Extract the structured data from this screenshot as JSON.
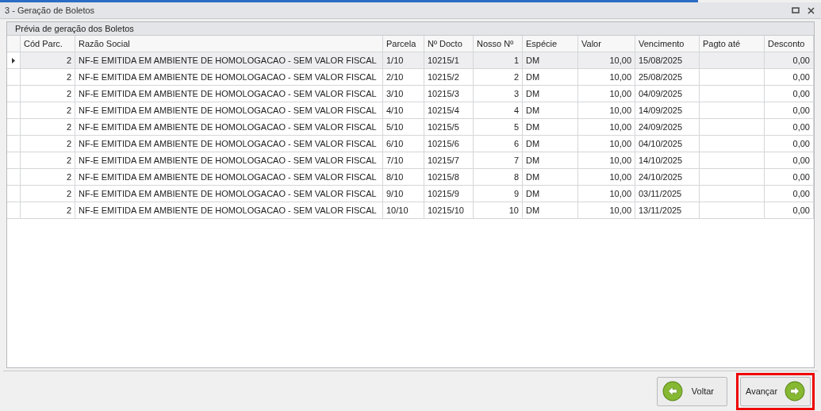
{
  "window": {
    "title": "3 - Geração de Boletos"
  },
  "panel": {
    "title": "Prévia de geração dos Boletos"
  },
  "table": {
    "columns": [
      "Cód Parc.",
      "Razão Social",
      "Parcela",
      "Nº Docto",
      "Nosso Nº",
      "Espécie",
      "Valor",
      "Vencimento",
      "Pagto até",
      "Desconto"
    ],
    "rows": [
      {
        "selected": true,
        "cells": [
          "2",
          "NF-E EMITIDA EM AMBIENTE DE HOMOLOGACAO - SEM VALOR FISCAL",
          "1/10",
          "10215/1",
          "1",
          "DM",
          "10,00",
          "15/08/2025",
          "",
          "0,00"
        ]
      },
      {
        "selected": false,
        "cells": [
          "2",
          "NF-E EMITIDA EM AMBIENTE DE HOMOLOGACAO - SEM VALOR FISCAL",
          "2/10",
          "10215/2",
          "2",
          "DM",
          "10,00",
          "25/08/2025",
          "",
          "0,00"
        ]
      },
      {
        "selected": false,
        "cells": [
          "2",
          "NF-E EMITIDA EM AMBIENTE DE HOMOLOGACAO - SEM VALOR FISCAL",
          "3/10",
          "10215/3",
          "3",
          "DM",
          "10,00",
          "04/09/2025",
          "",
          "0,00"
        ]
      },
      {
        "selected": false,
        "cells": [
          "2",
          "NF-E EMITIDA EM AMBIENTE DE HOMOLOGACAO - SEM VALOR FISCAL",
          "4/10",
          "10215/4",
          "4",
          "DM",
          "10,00",
          "14/09/2025",
          "",
          "0,00"
        ]
      },
      {
        "selected": false,
        "cells": [
          "2",
          "NF-E EMITIDA EM AMBIENTE DE HOMOLOGACAO - SEM VALOR FISCAL",
          "5/10",
          "10215/5",
          "5",
          "DM",
          "10,00",
          "24/09/2025",
          "",
          "0,00"
        ]
      },
      {
        "selected": false,
        "cells": [
          "2",
          "NF-E EMITIDA EM AMBIENTE DE HOMOLOGACAO - SEM VALOR FISCAL",
          "6/10",
          "10215/6",
          "6",
          "DM",
          "10,00",
          "04/10/2025",
          "",
          "0,00"
        ]
      },
      {
        "selected": false,
        "cells": [
          "2",
          "NF-E EMITIDA EM AMBIENTE DE HOMOLOGACAO - SEM VALOR FISCAL",
          "7/10",
          "10215/7",
          "7",
          "DM",
          "10,00",
          "14/10/2025",
          "",
          "0,00"
        ]
      },
      {
        "selected": false,
        "cells": [
          "2",
          "NF-E EMITIDA EM AMBIENTE DE HOMOLOGACAO - SEM VALOR FISCAL",
          "8/10",
          "10215/8",
          "8",
          "DM",
          "10,00",
          "24/10/2025",
          "",
          "0,00"
        ]
      },
      {
        "selected": false,
        "cells": [
          "2",
          "NF-E EMITIDA EM AMBIENTE DE HOMOLOGACAO - SEM VALOR FISCAL",
          "9/10",
          "10215/9",
          "9",
          "DM",
          "10,00",
          "03/11/2025",
          "",
          "0,00"
        ]
      },
      {
        "selected": false,
        "cells": [
          "2",
          "NF-E EMITIDA EM AMBIENTE DE HOMOLOGACAO - SEM VALOR FISCAL",
          "10/10",
          "10215/10",
          "10",
          "DM",
          "10,00",
          "13/11/2025",
          "",
          "0,00"
        ]
      }
    ]
  },
  "buttons": [
    {
      "label": "Voltar",
      "kind": "back",
      "highlighted": false
    },
    {
      "label": "Avançar",
      "kind": "next",
      "highlighted": true
    }
  ]
}
